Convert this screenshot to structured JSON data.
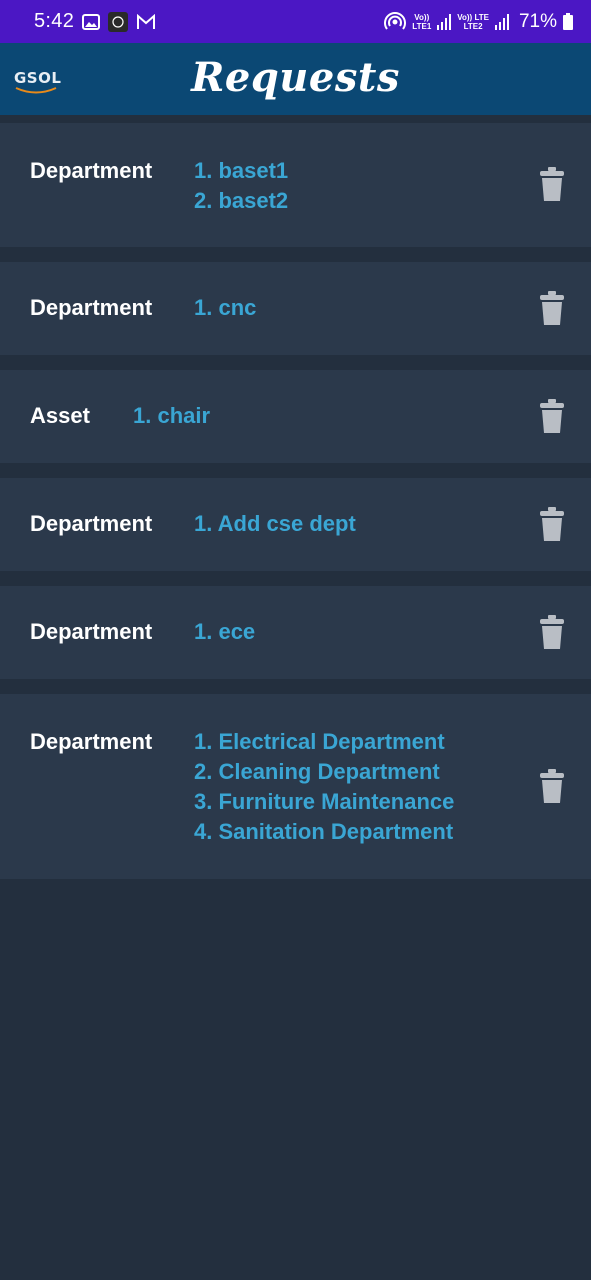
{
  "status_bar": {
    "time": "5:42",
    "net1_top": "Vo)) ",
    "net1_bottom": "LTE1",
    "net2_top": "Vo)) LTE",
    "net2_bottom": "LTE2",
    "battery": "71%",
    "icons": [
      "gallery-icon",
      "app-notification-icon",
      "gmail-icon",
      "hotspot-icon",
      "signal-icon",
      "battery-icon"
    ]
  },
  "app_bar": {
    "logo_text": "GSOL",
    "title": "Requests"
  },
  "requests": [
    {
      "type": "Department",
      "items": [
        "1. baset1",
        "2. baset2"
      ]
    },
    {
      "type": "Department",
      "items": [
        "1. cnc"
      ]
    },
    {
      "type": "Asset",
      "items": [
        "1. chair"
      ]
    },
    {
      "type": "Department",
      "items": [
        "1. Add cse dept"
      ]
    },
    {
      "type": "Department",
      "items": [
        "1. ece"
      ]
    },
    {
      "type": "Department",
      "items": [
        "1. Electrical Department",
        "2. Cleaning Department",
        "3. Furniture Maintenance",
        "4. Sanitation Department"
      ]
    }
  ],
  "colors": {
    "status_bar": "#4b17c4",
    "app_bar": "#0b4874",
    "background": "#232f3e",
    "card": "#2b394b",
    "item_text": "#3aa6d4",
    "trash_icon": "#b9bec5"
  }
}
